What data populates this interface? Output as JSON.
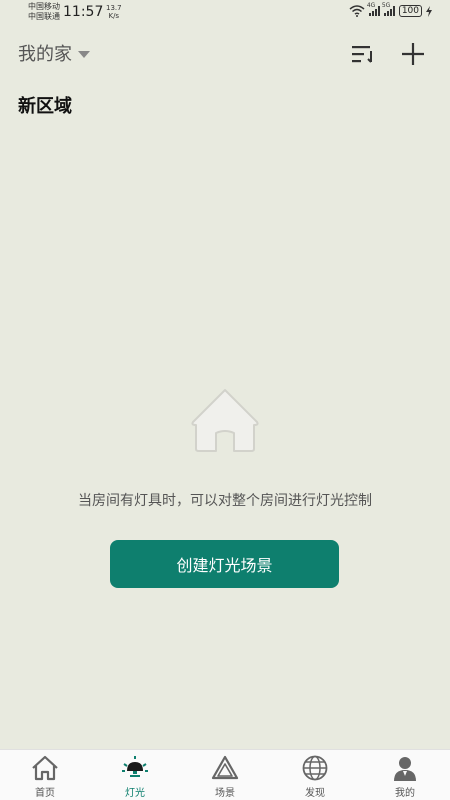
{
  "status_bar": {
    "carrier1": "中国移动",
    "carrier2": "中国联通",
    "time": "11:57",
    "speed_value": "13.7",
    "speed_unit": "K/s",
    "sig1_tag": "4G",
    "sig2_tag": "5G",
    "battery": "100"
  },
  "header": {
    "home_name": "我的家",
    "sort_icon": "sort-icon",
    "add_icon": "plus-icon"
  },
  "section": {
    "title": "新区域"
  },
  "empty_state": {
    "icon": "house-icon",
    "message": "当房间有灯具时，可以对整个房间进行灯光控制",
    "button_label": "创建灯光场景"
  },
  "bottom_nav": {
    "items": [
      {
        "label": "首页",
        "icon": "home-icon"
      },
      {
        "label": "灯光",
        "icon": "light-icon",
        "active": true
      },
      {
        "label": "场景",
        "icon": "scene-icon"
      },
      {
        "label": "发现",
        "icon": "globe-icon"
      },
      {
        "label": "我的",
        "icon": "user-icon"
      }
    ]
  },
  "colors": {
    "accent": "#0e7f6e",
    "background": "#e8eadf"
  }
}
